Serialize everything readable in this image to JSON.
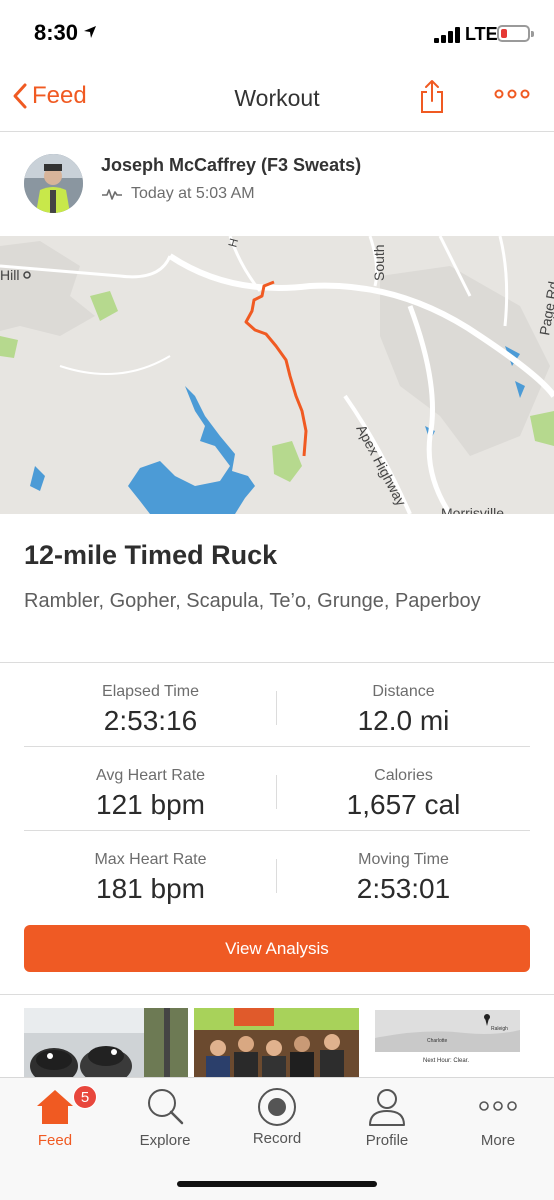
{
  "status_bar": {
    "time": "8:30",
    "network": "LTE",
    "location_icon": "location-arrow-icon",
    "battery_color": "#e53935"
  },
  "nav": {
    "back_label": "Feed",
    "title": "Workout",
    "share_icon": "share-icon",
    "more_icon": "more-horizontal-icon",
    "accent_color": "#f05a22"
  },
  "athlete": {
    "name": "Joseph McCaffrey (F3 Sweats)",
    "timestamp": "Today at 5:03 AM",
    "activity_icon": "heart-rate-pulse-icon"
  },
  "map": {
    "labels": [
      "Hill",
      "South",
      "Page Rd",
      "Apex Highway",
      "Morrisville"
    ]
  },
  "activity": {
    "title": "12-mile Timed Ruck",
    "description": "Rambler, Gopher, Scapula, Te’o, Grunge, Paperboy"
  },
  "stats": [
    {
      "left": {
        "label": "Elapsed Time",
        "value": "2:53:16"
      },
      "right": {
        "label": "Distance",
        "value": "12.0 mi"
      }
    },
    {
      "left": {
        "label": "Avg Heart Rate",
        "value": "121 bpm"
      },
      "right": {
        "label": "Calories",
        "value": "1,657 cal"
      }
    },
    {
      "left": {
        "label": "Max Heart Rate",
        "value": "181 bpm"
      },
      "right": {
        "label": "Moving Time",
        "value": "2:53:01"
      }
    }
  ],
  "analysis_button": {
    "label": "View Analysis",
    "color": "#ef5a24"
  },
  "photos": {
    "weather_labels": [
      "Raleigh",
      "Charlotte",
      "Next Hour: Clear."
    ]
  },
  "tab_bar": {
    "tabs": [
      {
        "label": "Feed",
        "icon": "home-icon",
        "active": true
      },
      {
        "label": "Explore",
        "icon": "search-icon",
        "active": false
      },
      {
        "label": "Record",
        "icon": "record-icon",
        "active": false
      },
      {
        "label": "Profile",
        "icon": "person-icon",
        "active": false
      },
      {
        "label": "More",
        "icon": "more-horizontal-icon",
        "active": false
      }
    ],
    "feed_badge": "5"
  }
}
